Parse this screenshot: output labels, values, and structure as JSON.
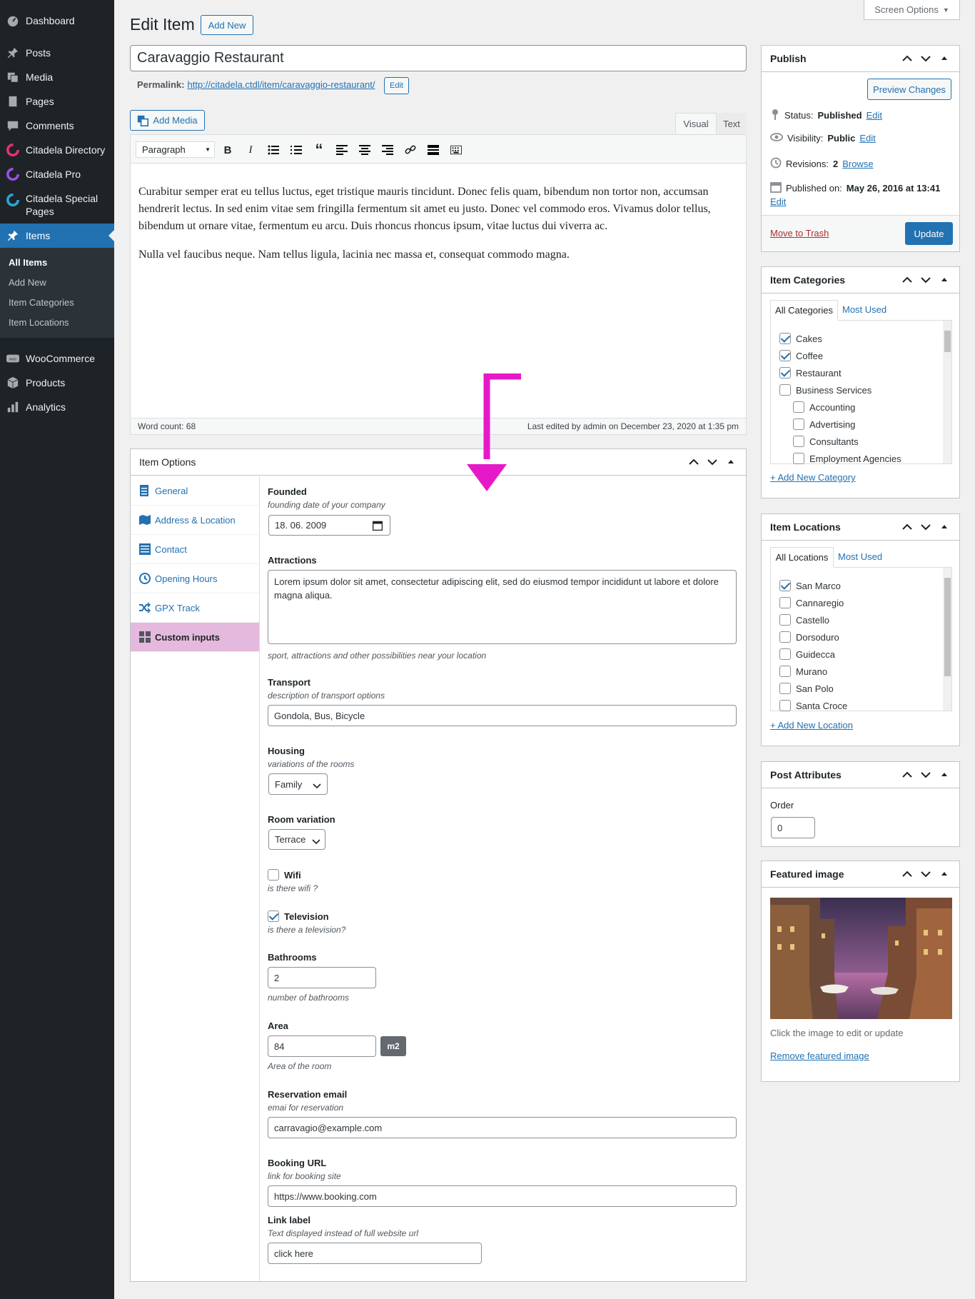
{
  "menu": {
    "dashboard": "Dashboard",
    "posts": "Posts",
    "media": "Media",
    "pages": "Pages",
    "comments": "Comments",
    "citadela_directory": "Citadela Directory",
    "citadela_pro": "Citadela Pro",
    "citadela_special": "Citadela Special",
    "citadela_special_2": "Pages",
    "items": "Items",
    "sub": [
      "All Items",
      "Add New",
      "Item Categories",
      "Item Locations"
    ],
    "woocommerce": "WooCommerce",
    "products": "Products",
    "analytics": "Analytics"
  },
  "header": {
    "title": "Edit Item",
    "add_new": "Add New",
    "screen_options": "Screen Options"
  },
  "post": {
    "title": "Caravaggio Restaurant",
    "permalink_label": "Permalink:",
    "permalink_url": "http://citadela.ctdl/item/caravaggio-restaurant/",
    "permalink_edit": "Edit"
  },
  "editor": {
    "add_media": "Add Media",
    "tab_visual": "Visual",
    "tab_text": "Text",
    "format": "Paragraph",
    "p1": "Curabitur semper erat eu tellus luctus, eget tristique mauris tincidunt. Donec felis quam, bibendum non tortor non, accumsan hendrerit lectus. In sed enim vitae sem fringilla fermentum sit amet eu justo. Donec vel commodo eros. Vivamus dolor tellus, bibendum ut ornare vitae, fermentum eu arcu. Duis rhoncus rhoncus ipsum, vitae luctus dui viverra ac.",
    "p2": "Nulla vel faucibus neque. Nam tellus ligula, lacinia nec massa et, consequat commodo magna.",
    "word_count": "Word count: 68",
    "last_edited": "Last edited by admin on December 23, 2020 at 1:35 pm"
  },
  "item_options": {
    "title": "Item Options",
    "nav": [
      "General",
      "Address & Location",
      "Contact",
      "Opening Hours",
      "GPX Track",
      "Custom inputs"
    ],
    "founded_label": "Founded",
    "founded_desc": "founding date of your company",
    "founded_value": "18. 06. 2009",
    "attractions_label": "Attractions",
    "attractions_value": "Lorem ipsum dolor sit amet, consectetur adipiscing elit, sed do eiusmod tempor incididunt ut labore et dolore magna aliqua.",
    "attractions_desc": "sport, attractions and other possibilities near your location",
    "transport_label": "Transport",
    "transport_desc": "description of transport options",
    "transport_value": "Gondola, Bus, Bicycle",
    "housing_label": "Housing",
    "housing_desc": "variations of the rooms",
    "housing_value": "Family",
    "room_label": "Room variation",
    "room_value": "Terrace",
    "wifi_label": "Wifi",
    "wifi_desc": "is there wifi ?",
    "tv_label": "Television",
    "tv_desc": "is there a television?",
    "bathrooms_label": "Bathrooms",
    "bathrooms_value": "2",
    "bathrooms_desc": "number of bathrooms",
    "area_label": "Area",
    "area_value": "84",
    "area_unit": "m2",
    "area_desc": "Area of the room",
    "email_label": "Reservation email",
    "email_desc": "emai for reservation",
    "email_value": "carravagio@example.com",
    "booking_label": "Booking URL",
    "booking_desc": "link for booking site",
    "booking_value": "https://www.booking.com",
    "link_label": "Link label",
    "link_desc": "Text displayed instead of full website url",
    "link_value": "click here"
  },
  "publish": {
    "title": "Publish",
    "preview": "Preview Changes",
    "status_label": "Status:",
    "status_value": "Published",
    "visibility_label": "Visibility:",
    "visibility_value": "Public",
    "revisions_label": "Revisions:",
    "revisions_value": "2",
    "browse": "Browse",
    "published_on_label": "Published on:",
    "published_on_value": "May 26, 2016 at 13:41",
    "edit": "Edit",
    "trash": "Move to Trash",
    "update": "Update"
  },
  "categories": {
    "title": "Item Categories",
    "tab_all": "All Categories",
    "tab_most": "Most Used",
    "items": [
      "Cakes",
      "Coffee",
      "Restaurant",
      "Business Services",
      "Accounting",
      "Advertising",
      "Consultants",
      "Employment Agencies"
    ],
    "add_new": "+ Add New Category"
  },
  "locations": {
    "title": "Item Locations",
    "tab_all": "All Locations",
    "tab_most": "Most Used",
    "items": [
      "San Marco",
      "Cannaregio",
      "Castello",
      "Dorsoduro",
      "Guidecca",
      "Murano",
      "San Polo",
      "Santa Croce"
    ],
    "add_new": "+ Add New Location"
  },
  "attributes": {
    "title": "Post Attributes",
    "order_label": "Order",
    "order_value": "0"
  },
  "featured": {
    "title": "Featured image",
    "hint": "Click the image to edit or update",
    "remove": "Remove featured image"
  },
  "colors": {
    "menu_bg": "#1d2327",
    "accent": "#2271b1",
    "active_tab": "#e4b9dd",
    "annotation_arrow": "#e619c8"
  }
}
